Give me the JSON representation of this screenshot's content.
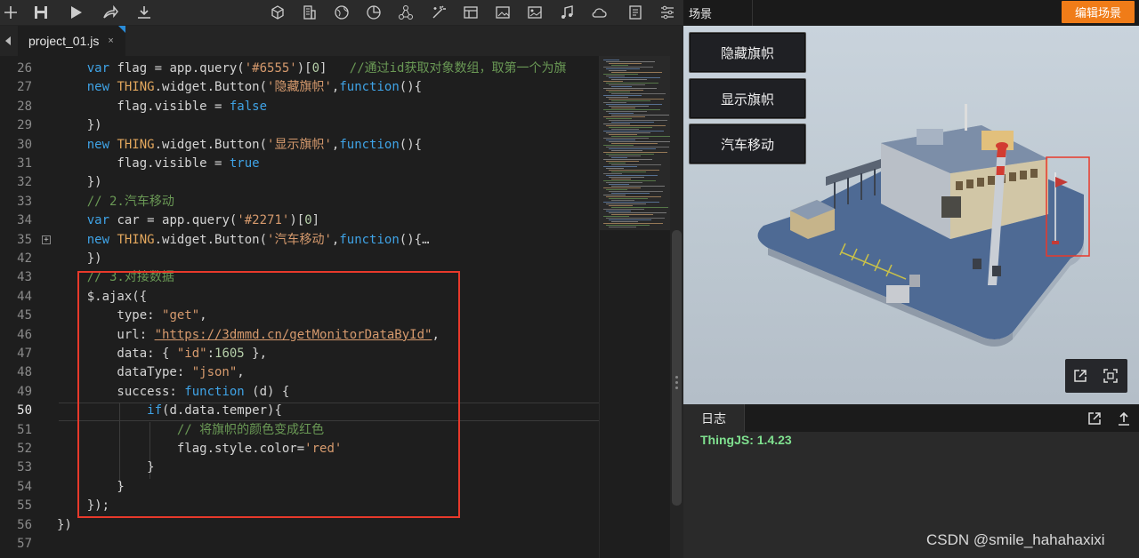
{
  "toolbar": {
    "icons": [
      "add-icon",
      "save-icon",
      "run-icon",
      "share-icon",
      "download-icon",
      "cube-icon",
      "building-icon",
      "globe-icon",
      "chart-icon",
      "network-icon",
      "magic-icon",
      "layout-icon",
      "image-icon",
      "picture-icon",
      "music-icon",
      "cloud-icon",
      "notes-icon",
      "settings-icon"
    ]
  },
  "tabs": {
    "active_label": "project_01.js",
    "close_glyph": "×"
  },
  "editor": {
    "lines": [
      {
        "n": "26",
        "html": "    <span class=\"kw\">var</span> flag = app.query(<span class=\"str\">'#6555'</span>)[<span class=\"num\">0</span>]   <span class=\"cmt\">//通过id获取对象数组，取第一个为旗</span>"
      },
      {
        "n": "27",
        "html": "    <span class=\"kw\">new</span> <span class=\"cls\">THING</span>.widget.Button(<span class=\"str\">'隐藏旗帜'</span>,<span class=\"kw\">function</span>(){"
      },
      {
        "n": "28",
        "html": "        flag.visible = <span class=\"bool\">false</span>"
      },
      {
        "n": "29",
        "html": "    })"
      },
      {
        "n": "30",
        "html": "    <span class=\"kw\">new</span> <span class=\"cls\">THING</span>.widget.Button(<span class=\"str\">'显示旗帜'</span>,<span class=\"kw\">function</span>(){"
      },
      {
        "n": "31",
        "html": "        flag.visible = <span class=\"bool\">true</span>"
      },
      {
        "n": "32",
        "html": "    })"
      },
      {
        "n": "33",
        "html": "    <span class=\"cmt\">// 2.汽车移动</span>"
      },
      {
        "n": "34",
        "html": "    <span class=\"kw\">var</span> car = app.query(<span class=\"str\">'#2271'</span>)[<span class=\"num\">0</span>]"
      },
      {
        "n": "35",
        "html": "    <span class=\"kw\">new</span> <span class=\"cls\">THING</span>.widget.Button(<span class=\"str\">'汽车移动'</span>,<span class=\"kw\">function</span>(){…",
        "fold": true
      },
      {
        "n": "42",
        "html": "    })"
      },
      {
        "n": "43",
        "html": "    <span class=\"cmt\">// 3.对接数据</span>"
      },
      {
        "n": "44",
        "html": "    $.ajax({"
      },
      {
        "n": "45",
        "html": "        type: <span class=\"str\">\"get\"</span>,"
      },
      {
        "n": "46",
        "html": "        url: <span class=\"url\">\"https://3dmmd.cn/getMonitorDataById\"</span>,"
      },
      {
        "n": "47",
        "html": "        data: { <span class=\"str\">\"id\"</span>:<span class=\"num\">1605</span> },"
      },
      {
        "n": "48",
        "html": "        dataType: <span class=\"str\">\"json\"</span>,"
      },
      {
        "n": "49",
        "html": "        success: <span class=\"kw\">function</span> (d) {"
      },
      {
        "n": "50",
        "html": "            <span class=\"kw\">if</span>(d.data.temper){",
        "current": true
      },
      {
        "n": "51",
        "html": "                <span class=\"cmt\">// 将旗帜的颜色变成红色</span>"
      },
      {
        "n": "52",
        "html": "                flag.style.color=<span class=\"str\">'red'</span>"
      },
      {
        "n": "53",
        "html": "            }"
      },
      {
        "n": "54",
        "html": "        }"
      },
      {
        "n": "55",
        "html": "    });"
      },
      {
        "n": "56",
        "html": "})"
      },
      {
        "n": "57",
        "html": ""
      }
    ]
  },
  "scene": {
    "tab_label": "场景",
    "edit_button": "编辑场景",
    "buttons": [
      "隐藏旗帜",
      "显示旗帜",
      "汽车移动"
    ]
  },
  "log": {
    "tab_label": "日志",
    "version_text": "ThingJS: 1.4.23"
  },
  "watermark": "CSDN @smile_hahahaxixi"
}
